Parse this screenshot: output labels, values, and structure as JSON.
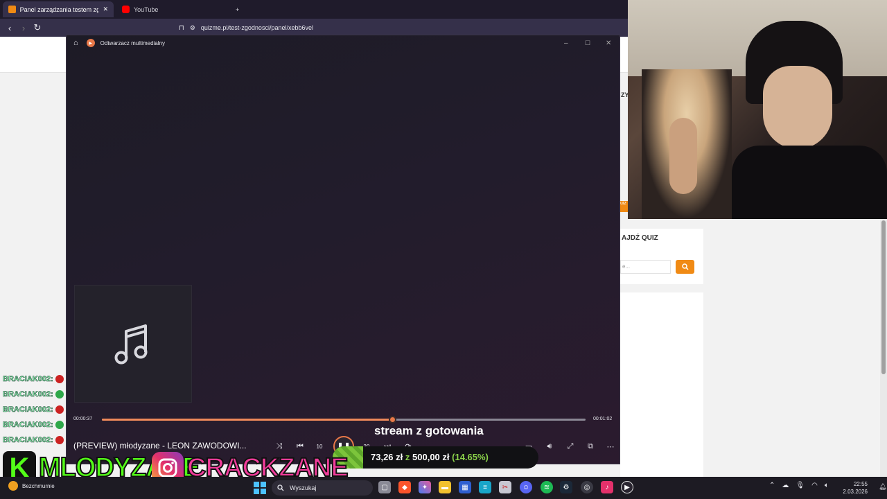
{
  "browser": {
    "tabs": [
      {
        "label": "Panel zarządzania testem zgodn",
        "active": true,
        "favicon_color": "#f08a14"
      },
      {
        "label": "YouTube",
        "active": false,
        "favicon_color": "#ff0000"
      }
    ],
    "new_tab": "+",
    "url": "quizme.pl/test-zgodnosci/panel/xebb6vel"
  },
  "background_page": {
    "fragment_zy": "ZY",
    "quiz_title": "AJDŹ QUIZ",
    "quiz_input_placeholder": "e...",
    "quiz_chip": "uiz"
  },
  "player": {
    "title": "Odtwarzacz multimedialny",
    "current_time": "00:00:37",
    "total_time": "00:01:02",
    "progress": 0.6,
    "song": "(PREVIEW) młodyzane - LEON ZAWODOWI...",
    "rewind_label": "10",
    "forward_label": "30"
  },
  "overlay": {
    "stream_title": "stream z gotowania",
    "goal_current": "73,26 zł",
    "goal_sep": "z",
    "goal_target": "500,00 zł",
    "goal_pct": "(14.65%)",
    "goal_fraction": 0.1465,
    "chat": [
      {
        "user": "BRACIAK002:",
        "emote_color": "#cc2222"
      },
      {
        "user": "BRACIAK002:",
        "emote_color": "#2fa84a"
      },
      {
        "user": "BRACIAK002:",
        "emote_color": "#cc2222"
      },
      {
        "user": "BRACIAK002:",
        "emote_color": "#2fa84a"
      },
      {
        "user": "BRACIAK002:",
        "emote_color": "#cc2222"
      }
    ],
    "kick_logo": "K",
    "kick_name": "MLODYZANE",
    "ig_name": "CRACKZANE"
  },
  "taskbar": {
    "weather_label": "Bezchmurnie",
    "search_placeholder": "Wyszukaj",
    "time": "22:55",
    "date": "2.03.2026",
    "accent": "#53fc18"
  }
}
